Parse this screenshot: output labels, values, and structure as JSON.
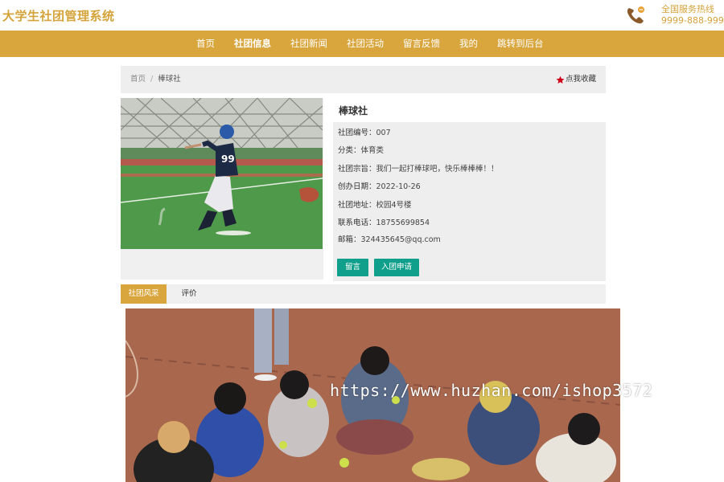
{
  "site": {
    "title": "大学生社团管理系统"
  },
  "hotline": {
    "icon": "phone-icon",
    "label": "全国服务热线",
    "number": "9999-888-999"
  },
  "nav": {
    "items": [
      {
        "label": "首页",
        "active": false
      },
      {
        "label": "社团信息",
        "active": true
      },
      {
        "label": "社团新闻",
        "active": false
      },
      {
        "label": "社团活动",
        "active": false
      },
      {
        "label": "留言反馈",
        "active": false
      },
      {
        "label": "我的",
        "active": false
      },
      {
        "label": "跳转到后台",
        "active": false
      }
    ]
  },
  "breadcrumb": {
    "home": "首页",
    "separator": "/",
    "current": "棒球社"
  },
  "favorite": {
    "icon": "star-icon",
    "label": "点我收藏"
  },
  "club": {
    "name": "棒球社",
    "fields": [
      {
        "label": "社团编号：",
        "value": "007"
      },
      {
        "label": "分类：",
        "value": "体育类"
      },
      {
        "label": "社团宗旨：",
        "value": "我们一起打棒球吧，快乐棒棒棒！！"
      },
      {
        "label": "创办日期：",
        "value": "2022-10-26"
      },
      {
        "label": "社团地址：",
        "value": "校园4号楼"
      },
      {
        "label": "联系电话：",
        "value": "18755699854"
      },
      {
        "label": "邮箱：",
        "value": "324435645@qq.com"
      }
    ],
    "buttons": {
      "message": "留言",
      "join": "入团申请"
    }
  },
  "tabs": {
    "active": "社团风采",
    "other": "评价"
  },
  "watermark": "https://www.huzhan.com/ishop3572",
  "colors": {
    "brand": "#d9a63e",
    "title_gold": "#d4a33a",
    "button_teal": "#109f8a",
    "star_red": "#d0021b"
  }
}
